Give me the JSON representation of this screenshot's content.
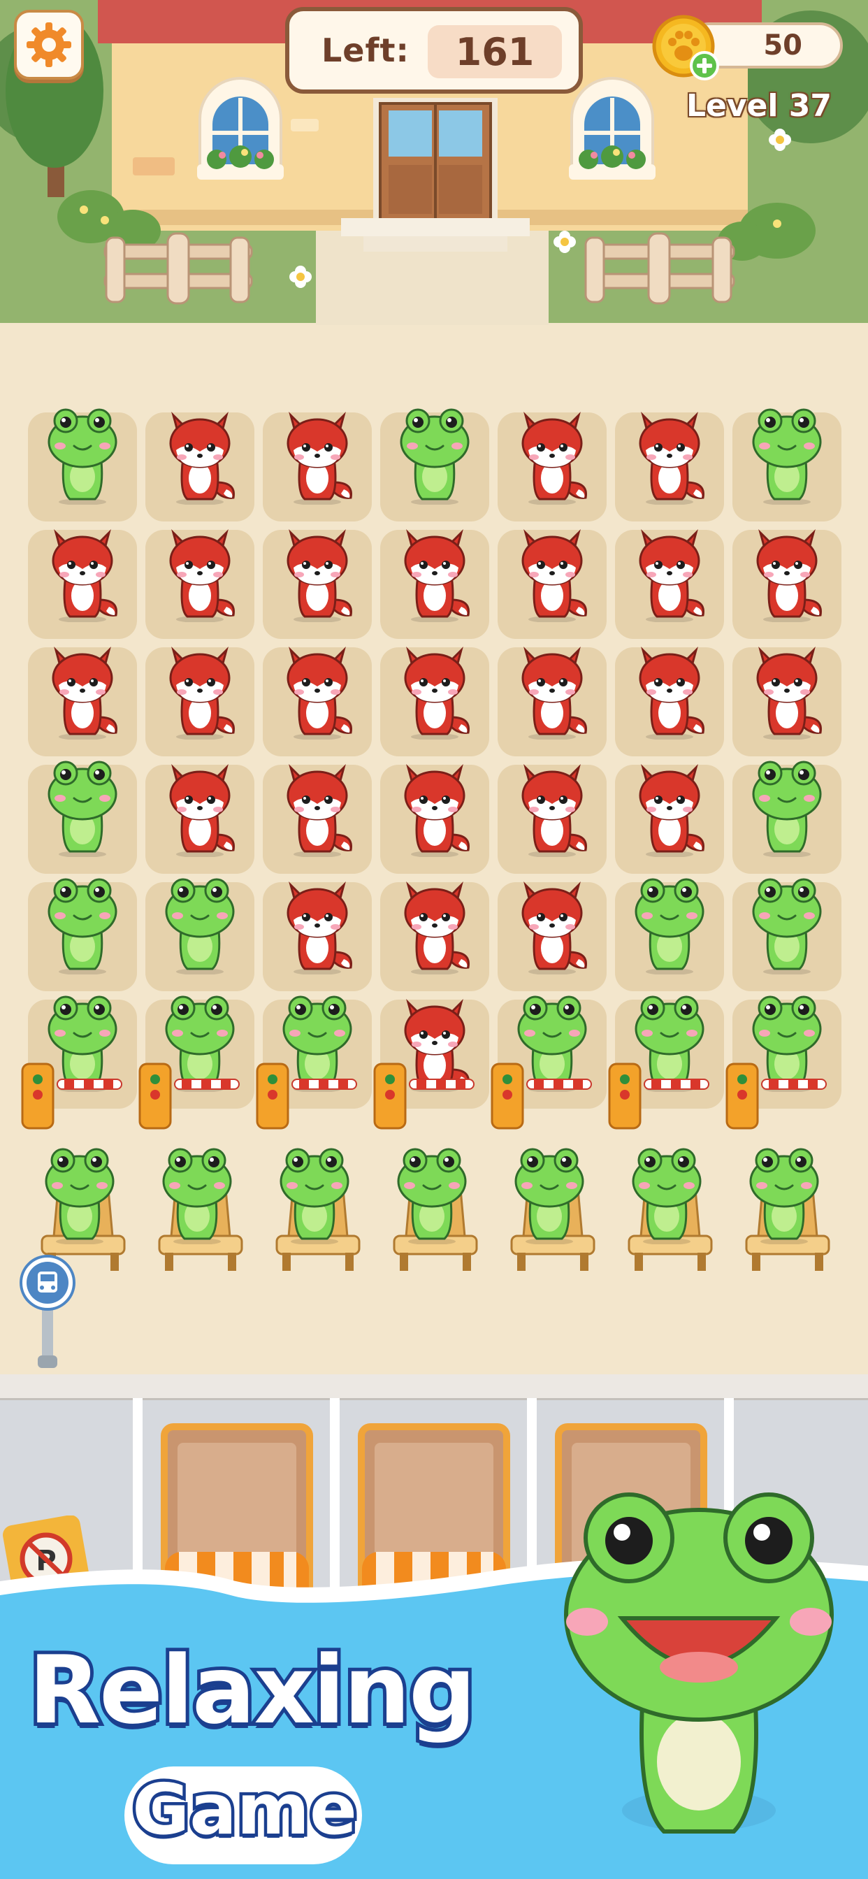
{
  "hud": {
    "left_label": "Left:",
    "left_value": "161",
    "coins": "50",
    "level": "Level 37"
  },
  "board": {
    "rows": [
      [
        "frog",
        "fox",
        "fox",
        "frog",
        "fox",
        "fox",
        "frog"
      ],
      [
        "fox",
        "fox",
        "fox",
        "fox",
        "fox",
        "fox",
        "fox"
      ],
      [
        "fox",
        "fox",
        "fox",
        "fox",
        "fox",
        "fox",
        "fox"
      ],
      [
        "frog",
        "fox",
        "fox",
        "fox",
        "fox",
        "fox",
        "frog"
      ],
      [
        "frog",
        "frog",
        "fox",
        "fox",
        "fox",
        "frog",
        "frog"
      ],
      [
        "frog",
        "frog",
        "frog",
        "fox",
        "frog",
        "frog",
        "frog"
      ]
    ],
    "queue": [
      "frog",
      "frog",
      "frog",
      "frog",
      "frog",
      "frog",
      "frog"
    ]
  },
  "promo": {
    "title": "Relaxing",
    "subtitle": "Game"
  },
  "colors": {
    "board_bg": "#f3e6cc",
    "tile": "#e6d2ac",
    "frog": "#7ed957",
    "fox": "#d9372b",
    "banner_blue": "#5cc6f2",
    "text_outline": "#1b3f8f"
  },
  "icons": {
    "settings": "gear-icon",
    "coin": "paw-coin-icon",
    "add": "plus-icon",
    "bus_stop": "bus-stop-icon",
    "no_parking": "no-parking-icon"
  }
}
